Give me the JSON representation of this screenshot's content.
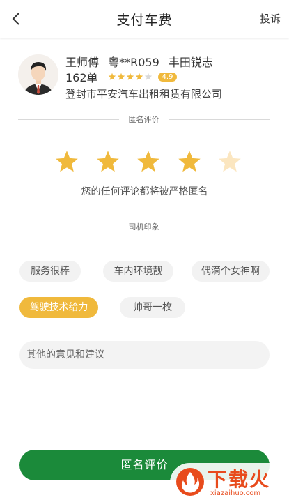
{
  "header": {
    "title": "支付车费",
    "complain_label": "投诉",
    "back_icon": "chevron-left-icon"
  },
  "driver": {
    "name": "王师傅",
    "plate": "粤**R059",
    "car": "丰田锐志",
    "orders": "162单",
    "star_rating": 4,
    "star_max": 5,
    "rating": "4.9",
    "company": "登封市平安汽车出租租赁有限公司"
  },
  "rating_section": {
    "title": "匿名评价",
    "selected_stars": 4,
    "max_stars": 5,
    "note": "您的任何评论都将被严格匿名"
  },
  "impression_section": {
    "title": "司机印象",
    "tags": [
      {
        "label": "服务很棒",
        "selected": false
      },
      {
        "label": "车内环境靓",
        "selected": false
      },
      {
        "label": "偶滴个女神啊",
        "selected": false
      },
      {
        "label": "驾驶技术给力",
        "selected": true
      },
      {
        "label": "帅哥一枚",
        "selected": false
      }
    ]
  },
  "suggestion": {
    "placeholder": "其他的意见和建议",
    "value": ""
  },
  "submit": {
    "label": "匿名评价"
  },
  "watermark": {
    "text": "下载火",
    "url": "xiazaihuo.com"
  },
  "colors": {
    "accent": "#f0b93c",
    "star_dim": "#fbe6c0",
    "primary": "#1b8a3a",
    "tag_bg": "#f2f2f2",
    "watermark": "#e84b1c"
  }
}
